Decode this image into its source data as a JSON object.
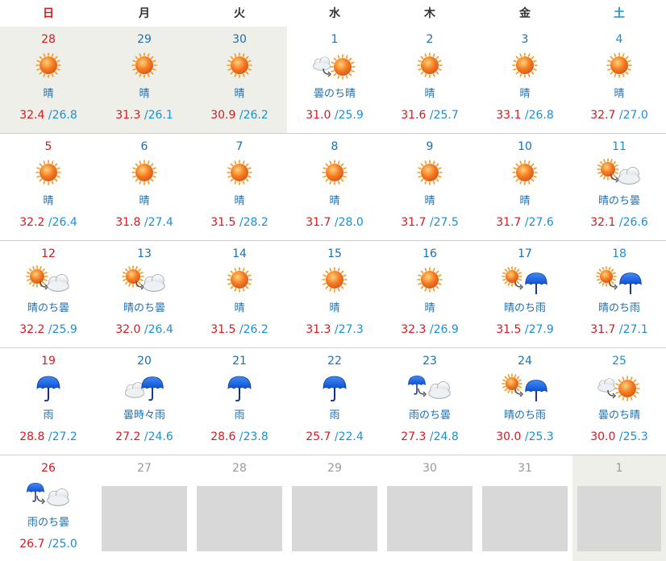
{
  "calendar": {
    "weekdays": [
      "日",
      "月",
      "火",
      "水",
      "木",
      "金",
      "土"
    ],
    "colors": {
      "high_temp": "#d6191f",
      "low_temp": "#1c8fd4",
      "sunday": "#d6191f",
      "saturday": "#1c8fd4",
      "past_bg": "#efefea",
      "empty_box": "#d8d8d8"
    },
    "weeks": [
      [
        {
          "date": "28",
          "icon": "sun-icon",
          "weather": "晴",
          "high": "32.4",
          "low": "/26.8",
          "past": true
        },
        {
          "date": "29",
          "icon": "sun-icon",
          "weather": "晴",
          "high": "31.3",
          "low": "/26.1",
          "past": true
        },
        {
          "date": "30",
          "icon": "sun-icon",
          "weather": "晴",
          "high": "30.9",
          "low": "/26.2",
          "past": true
        },
        {
          "date": "1",
          "icon": "cloud-then-sun-icon",
          "weather": "曇のち晴",
          "high": "31.0",
          "low": "/25.9"
        },
        {
          "date": "2",
          "icon": "sun-icon",
          "weather": "晴",
          "high": "31.6",
          "low": "/25.7"
        },
        {
          "date": "3",
          "icon": "sun-icon",
          "weather": "晴",
          "high": "33.1",
          "low": "/26.8"
        },
        {
          "date": "4",
          "icon": "sun-icon",
          "weather": "晴",
          "high": "32.7",
          "low": "/27.0"
        }
      ],
      [
        {
          "date": "5",
          "icon": "sun-icon",
          "weather": "晴",
          "high": "32.2",
          "low": "/26.4"
        },
        {
          "date": "6",
          "icon": "sun-icon",
          "weather": "晴",
          "high": "31.8",
          "low": "/27.4"
        },
        {
          "date": "7",
          "icon": "sun-icon",
          "weather": "晴",
          "high": "31.5",
          "low": "/28.2"
        },
        {
          "date": "8",
          "icon": "sun-icon",
          "weather": "晴",
          "high": "31.7",
          "low": "/28.0"
        },
        {
          "date": "9",
          "icon": "sun-icon",
          "weather": "晴",
          "high": "31.7",
          "low": "/27.5"
        },
        {
          "date": "10",
          "icon": "sun-icon",
          "weather": "晴",
          "high": "31.7",
          "low": "/27.6"
        },
        {
          "date": "11",
          "icon": "sun-then-cloud-icon",
          "weather": "晴のち曇",
          "high": "32.1",
          "low": "/26.6"
        }
      ],
      [
        {
          "date": "12",
          "icon": "sun-then-cloud-icon",
          "weather": "晴のち曇",
          "high": "32.2",
          "low": "/25.9"
        },
        {
          "date": "13",
          "icon": "sun-then-cloud-icon",
          "weather": "晴のち曇",
          "high": "32.0",
          "low": "/26.4"
        },
        {
          "date": "14",
          "icon": "sun-icon",
          "weather": "晴",
          "high": "31.5",
          "low": "/26.2"
        },
        {
          "date": "15",
          "icon": "sun-icon",
          "weather": "晴",
          "high": "31.3",
          "low": "/27.3"
        },
        {
          "date": "16",
          "icon": "sun-icon",
          "weather": "晴",
          "high": "32.3",
          "low": "/26.9"
        },
        {
          "date": "17",
          "icon": "sun-then-rain-icon",
          "weather": "晴のち雨",
          "high": "31.5",
          "low": "/27.9"
        },
        {
          "date": "18",
          "icon": "sun-then-rain-icon",
          "weather": "晴のち雨",
          "high": "31.7",
          "low": "/27.1"
        }
      ],
      [
        {
          "date": "19",
          "icon": "umbrella-icon",
          "weather": "雨",
          "high": "28.8",
          "low": "/27.2"
        },
        {
          "date": "20",
          "icon": "cloud-sometimes-rain-icon",
          "weather": "曇時々雨",
          "high": "27.2",
          "low": "/24.6"
        },
        {
          "date": "21",
          "icon": "umbrella-icon",
          "weather": "雨",
          "high": "28.6",
          "low": "/23.8"
        },
        {
          "date": "22",
          "icon": "umbrella-icon",
          "weather": "雨",
          "high": "25.7",
          "low": "/22.4"
        },
        {
          "date": "23",
          "icon": "rain-then-cloud-icon",
          "weather": "雨のち曇",
          "high": "27.3",
          "low": "/24.8"
        },
        {
          "date": "24",
          "icon": "sun-then-rain-icon",
          "weather": "晴のち雨",
          "high": "30.0",
          "low": "/25.3"
        },
        {
          "date": "25",
          "icon": "cloud-then-sun-icon",
          "weather": "曇のち晴",
          "high": "30.0",
          "low": "/25.3"
        }
      ],
      [
        {
          "date": "26",
          "icon": "rain-then-cloud-icon",
          "weather": "雨のち曇",
          "high": "26.7",
          "low": "/25.0"
        },
        {
          "date": "27",
          "empty": true
        },
        {
          "date": "28",
          "empty": true
        },
        {
          "date": "29",
          "empty": true
        },
        {
          "date": "30",
          "empty": true
        },
        {
          "date": "31",
          "empty": true
        },
        {
          "date": "1",
          "empty": true,
          "tinted": true
        }
      ]
    ]
  }
}
